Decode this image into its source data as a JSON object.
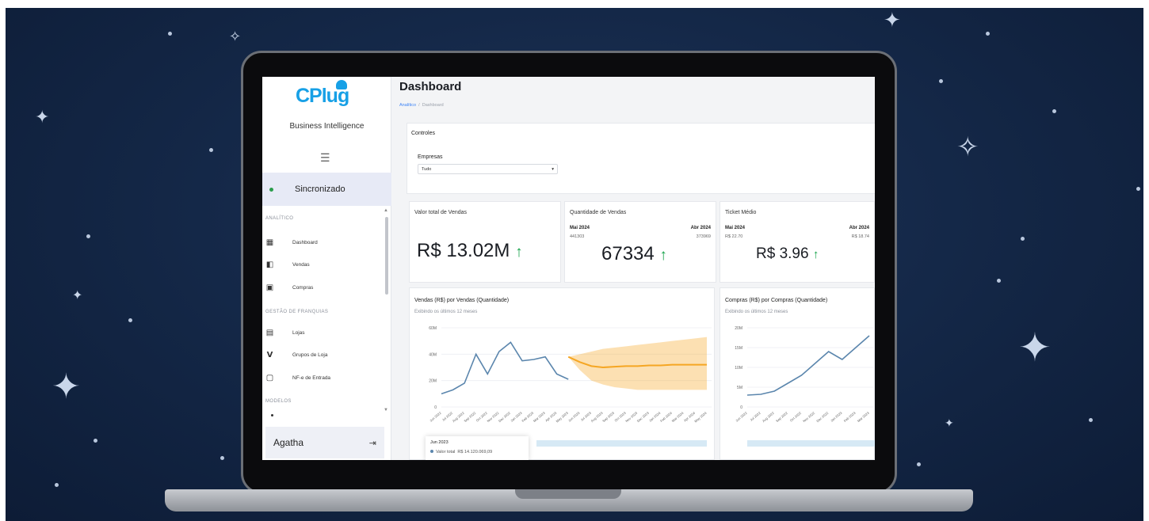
{
  "app": {
    "logo_text": "CPlug",
    "subtitle": "Business Intelligence",
    "sync_label": "Sincronizado"
  },
  "sidebar": {
    "sections": [
      {
        "label": "ANALÍTICO",
        "items": [
          {
            "label": "Dashboard",
            "icon": "dashboard-icon"
          },
          {
            "label": "Vendas",
            "icon": "sales-icon"
          },
          {
            "label": "Compras",
            "icon": "purchases-icon"
          }
        ]
      },
      {
        "label": "GESTÃO DE FRANQUIAS",
        "items": [
          {
            "label": "Lojas",
            "icon": "store-icon"
          },
          {
            "label": "Grupos de Loja",
            "icon": "store-group-icon"
          },
          {
            "label": "NF-e de Entrada",
            "icon": "invoice-icon"
          }
        ]
      },
      {
        "label": "MODELOS",
        "items": []
      }
    ],
    "user_name": "Agatha"
  },
  "header": {
    "title": "Dashboard",
    "breadcrumb_link": "Analítico",
    "breadcrumb_sep": "/",
    "breadcrumb_current": "Dashboard"
  },
  "controls": {
    "title": "Controles",
    "empresas_label": "Empresas",
    "empresas_value": "Tudo"
  },
  "kpis": {
    "total": {
      "title": "Valor total de Vendas",
      "value": "R$ 13.02M"
    },
    "quantity": {
      "title": "Quantidade de Vendas",
      "left_label": "Mai 2024",
      "left_value": "441303",
      "right_label": "Abr 2024",
      "right_value": "373969",
      "value": "67334"
    },
    "ticket": {
      "title": "Ticket Médio",
      "left_label": "Mai 2024",
      "left_value": "R$ 22.70",
      "right_label": "Abr 2024",
      "right_value": "R$ 18.74",
      "value": "R$ 3.96"
    }
  },
  "colors": {
    "accent": "#3b82f6",
    "up": "#16a34a",
    "line": "#5b86ad",
    "forecast": "#f5a623"
  },
  "tooltip": {
    "date": "Jun 2023",
    "series": "Valor total",
    "value": "R$ 14.120.069,09"
  },
  "chart_data": [
    {
      "type": "line",
      "title": "Vendas (R$) por Vendas (Quantidade)",
      "subtitle": "Exibindo os últimos 12 meses",
      "y_ticks": [
        "0",
        "20M",
        "40M",
        "60M"
      ],
      "ylim": [
        0,
        60
      ],
      "x": [
        "Jun 2022",
        "Jul 2022",
        "Aug 2022",
        "Sep 2022",
        "Oct 2022",
        "Nov 2022",
        "Dec 2022",
        "Jan 2023",
        "Feb 2023",
        "Mar 2023",
        "Apr 2023",
        "May 2023",
        "Jun 2023",
        "Jul 2023",
        "Aug 2023",
        "Sep 2023",
        "Oct 2023",
        "Nov 2023",
        "Dec 2023",
        "Jan 2024",
        "Feb 2024",
        "Mar 2024",
        "Apr 2024",
        "May 2024"
      ],
      "series": [
        {
          "values": [
            10,
            13,
            18,
            40,
            25,
            42,
            49,
            35,
            36,
            38,
            25,
            21,
            null,
            null,
            null,
            null,
            null,
            null,
            null,
            null,
            null,
            null,
            null,
            null
          ]
        },
        {
          "values": [
            null,
            null,
            null,
            null,
            null,
            null,
            null,
            null,
            null,
            null,
            null,
            38,
            34,
            31,
            30,
            30.5,
            31,
            31,
            31.5,
            31.5,
            32,
            32,
            32,
            32
          ]
        }
      ],
      "band_upper": [
        null,
        null,
        null,
        null,
        null,
        null,
        null,
        null,
        null,
        null,
        null,
        38,
        40,
        42,
        44,
        45,
        46,
        47,
        48,
        49,
        50,
        51,
        52,
        53
      ],
      "band_lower": [
        null,
        null,
        null,
        null,
        null,
        null,
        null,
        null,
        null,
        null,
        null,
        38,
        28,
        20,
        17,
        15,
        14,
        13,
        13,
        13,
        13,
        13,
        13,
        13
      ]
    },
    {
      "type": "line",
      "title": "Compras (R$) por Compras (Quantidade)",
      "subtitle": "Exibindo os últimos 12 meses",
      "y_ticks": [
        "0",
        "5M",
        "10M",
        "15M",
        "20M"
      ],
      "ylim": [
        0,
        20
      ],
      "x": [
        "Jun 2022",
        "Jul 2022",
        "Aug 2022",
        "Sep 2022",
        "Oct 2022",
        "Nov 2022",
        "Dec 2022",
        "Jan 2023",
        "Feb 2023",
        "Mar 2023"
      ],
      "series": [
        {
          "values": [
            3,
            3.2,
            4,
            6,
            8,
            11,
            14,
            12,
            15,
            18
          ]
        }
      ]
    }
  ]
}
